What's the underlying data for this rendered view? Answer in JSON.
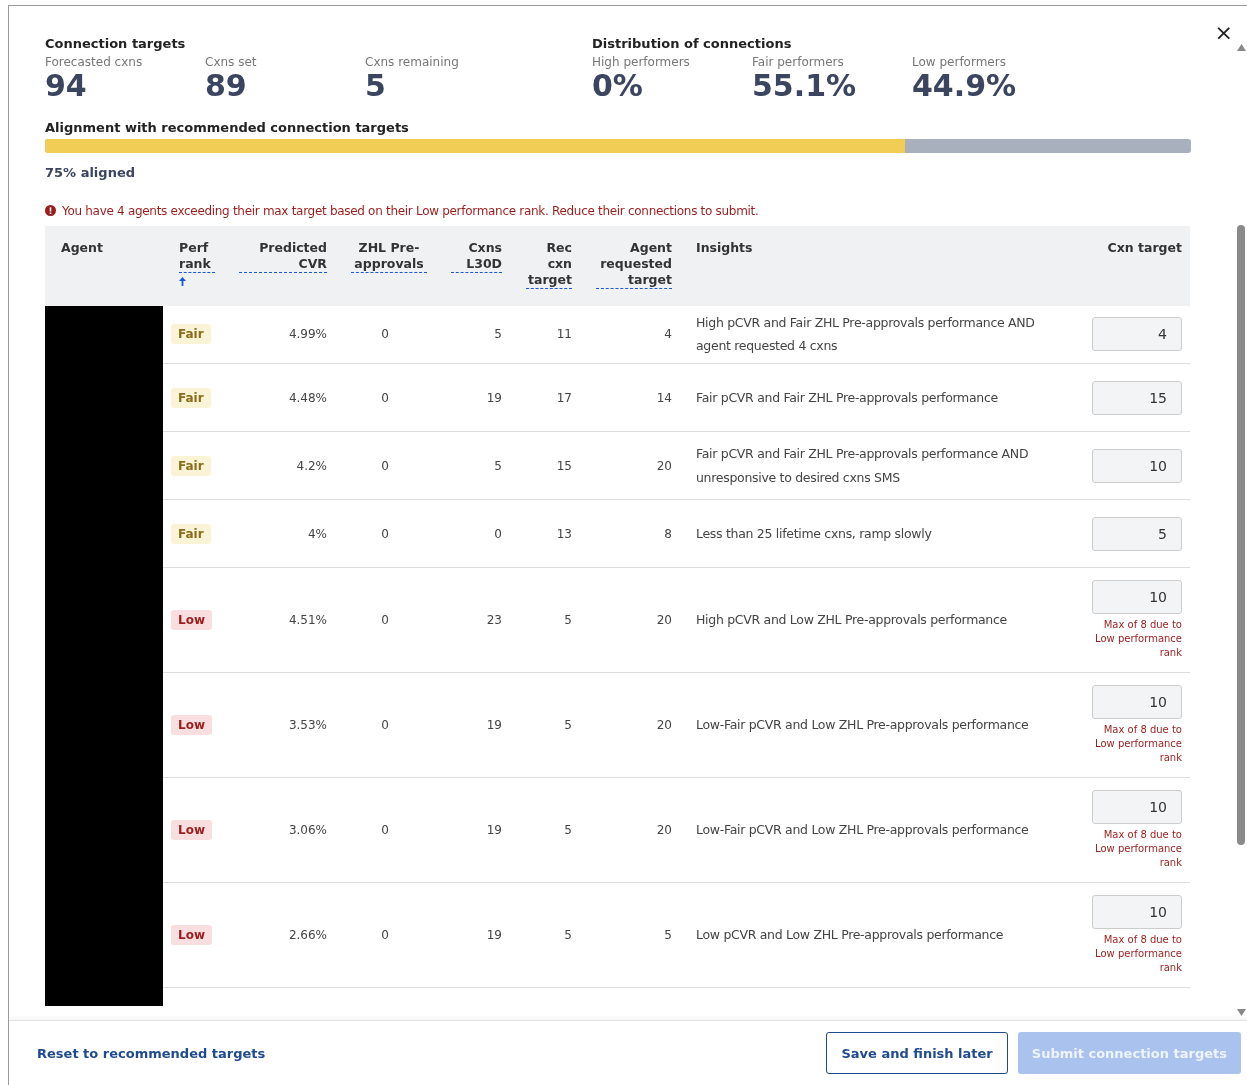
{
  "connection_targets": {
    "title": "Connection targets",
    "stats": [
      {
        "label": "Forecasted cxns",
        "value": "94"
      },
      {
        "label": "Cxns set",
        "value": "89"
      },
      {
        "label": "Cxns remaining",
        "value": "5"
      }
    ]
  },
  "distribution": {
    "title": "Distribution of connections",
    "stats": [
      {
        "label": "High performers",
        "value": "0%"
      },
      {
        "label": "Fair performers",
        "value": "55.1%"
      },
      {
        "label": "Low performers",
        "value": "44.9%"
      }
    ]
  },
  "alignment": {
    "title": "Alignment with recommended connection targets",
    "level": 0.75,
    "caption": "75% aligned"
  },
  "error_message": "You have 4 agents exceeding their max target based on their Low performance rank. Reduce their connections to submit.",
  "close": "×",
  "table": {
    "columns": [
      {
        "label": "Agent",
        "tooltip": false,
        "sorted": false
      },
      {
        "label": "Perf rank",
        "tooltip": true,
        "sorted": true
      },
      {
        "label": "Predicted CVR",
        "tooltip": true,
        "sorted": false
      },
      {
        "label": "ZHL Pre-approvals",
        "tooltip": true,
        "sorted": false
      },
      {
        "label": "Cxns L30D",
        "tooltip": true,
        "sorted": false
      },
      {
        "label": "Rec cxn target",
        "tooltip": true,
        "sorted": false
      },
      {
        "label": "Agent requested target",
        "tooltip": true,
        "sorted": false
      },
      {
        "label": "Insights",
        "tooltip": false,
        "sorted": false
      },
      {
        "label": "Cxn target",
        "tooltip": false,
        "sorted": false
      }
    ],
    "rows": [
      {
        "rank": "Fair",
        "kind": "fair",
        "cvr": "4.99%",
        "zhl": "0",
        "l30d": "5",
        "rec": "11",
        "requested": "4",
        "insight": "High pCVR and Fair ZHL Pre-approvals performance AND agent requested 4 cxns",
        "target": "4"
      },
      {
        "rank": "Fair",
        "kind": "fair",
        "cvr": "4.48%",
        "zhl": "0",
        "l30d": "19",
        "rec": "17",
        "requested": "14",
        "insight": "Fair pCVR and Fair ZHL Pre-approvals performance",
        "target": "15"
      },
      {
        "rank": "Fair",
        "kind": "fair",
        "cvr": "4.2%",
        "zhl": "0",
        "l30d": "5",
        "rec": "15",
        "requested": "20",
        "insight": "Fair pCVR and Fair ZHL Pre-approvals performance AND unresponsive to desired cxns SMS",
        "target": "10"
      },
      {
        "rank": "Fair",
        "kind": "fair",
        "cvr": "4%",
        "zhl": "0",
        "l30d": "0",
        "rec": "13",
        "requested": "8",
        "insight": "Less than 25 lifetime cxns, ramp slowly",
        "target": "5"
      },
      {
        "rank": "Low",
        "kind": "low",
        "cvr": "4.51%",
        "zhl": "0",
        "l30d": "23",
        "rec": "5",
        "requested": "20",
        "insight": "High pCVR and Low ZHL Pre-approvals performance",
        "target": "10",
        "warning": "Max of 8 due to Low performance rank"
      },
      {
        "rank": "Low",
        "kind": "low",
        "cvr": "3.53%",
        "zhl": "0",
        "l30d": "19",
        "rec": "5",
        "requested": "20",
        "insight": "Low-Fair pCVR and Low ZHL Pre-approvals performance",
        "target": "10",
        "warning": "Max of 8 due to Low performance rank"
      },
      {
        "rank": "Low",
        "kind": "low",
        "cvr": "3.06%",
        "zhl": "0",
        "l30d": "19",
        "rec": "5",
        "requested": "20",
        "insight": "Low-Fair pCVR and Low ZHL Pre-approvals performance",
        "target": "10",
        "warning": "Max of 8 due to Low performance rank"
      },
      {
        "rank": "Low",
        "kind": "low",
        "cvr": "2.66%",
        "zhl": "0",
        "l30d": "19",
        "rec": "5",
        "requested": "5",
        "insight": "Low pCVR and Low ZHL Pre-approvals performance",
        "target": "10",
        "warning": "Max of 8 due to Low performance rank"
      }
    ]
  },
  "footer": {
    "reset": "Reset to recommended targets",
    "save": "Save and finish later",
    "submit": {
      "label": "Submit connection targets",
      "disabled": true
    }
  }
}
